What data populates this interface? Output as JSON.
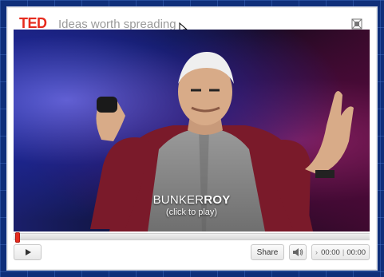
{
  "header": {
    "logo": "TED",
    "tagline": "Ideas worth spreading"
  },
  "video": {
    "speaker_first": "BUNKER",
    "speaker_last": "ROY",
    "cta": "(click to play)"
  },
  "progress": {
    "played_fraction": 0
  },
  "controls": {
    "share_label": "Share",
    "time_current": "00:00",
    "time_separator": "|",
    "time_total": "00:00"
  },
  "icons": {
    "fullscreen": "fullscreen-icon",
    "play": "play-icon",
    "volume": "speaker-icon",
    "cursor": "mouse-cursor-icon"
  },
  "colors": {
    "brand_red": "#e62b1e",
    "page_background": "#0f2f7a"
  }
}
